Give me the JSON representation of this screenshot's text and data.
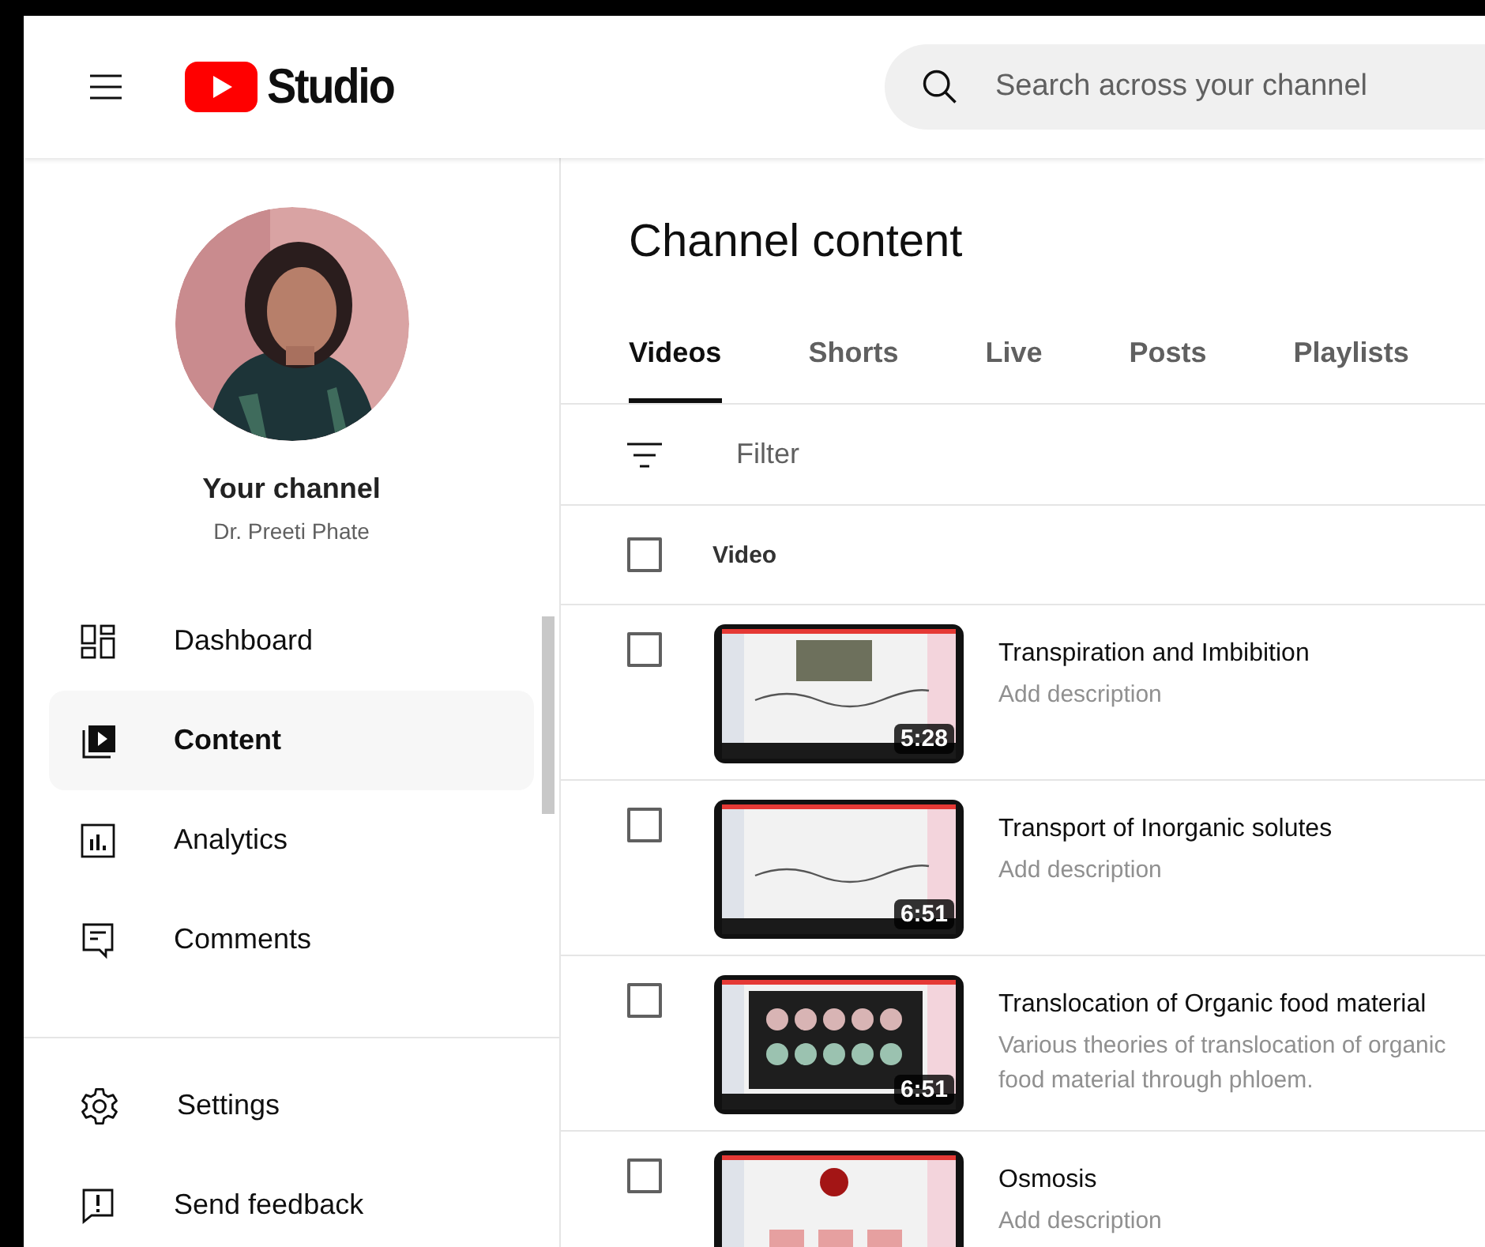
{
  "header": {
    "logo_text": "Studio",
    "search": {
      "placeholder": "Search across your channel"
    }
  },
  "channel": {
    "title": "Your channel",
    "name": "Dr. Preeti Phate"
  },
  "nav": [
    {
      "label": "Dashboard",
      "kind": "dashboard",
      "selected": false
    },
    {
      "label": "Content",
      "kind": "content",
      "selected": true
    },
    {
      "label": "Analytics",
      "kind": "analytics",
      "selected": false
    },
    {
      "label": "Comments",
      "kind": "comments",
      "selected": false
    }
  ],
  "nav_footer": [
    {
      "label": "Settings",
      "kind": "settings"
    },
    {
      "label": "Send feedback",
      "kind": "feedback"
    }
  ],
  "page_title": "Channel content",
  "tabs": [
    {
      "label": "Videos",
      "selected": true
    },
    {
      "label": "Shorts",
      "selected": false
    },
    {
      "label": "Live",
      "selected": false
    },
    {
      "label": "Posts",
      "selected": false
    },
    {
      "label": "Playlists",
      "selected": false
    }
  ],
  "filter": {
    "placeholder": "Filter"
  },
  "table": {
    "select_all": {
      "checked": false
    },
    "column": "Video",
    "rows": [
      {
        "checked": false,
        "title": "Transpiration and Imbibition",
        "description": "Add description",
        "duration": "5:28"
      },
      {
        "checked": false,
        "title": "Transport of Inorganic solutes",
        "description": "Add description",
        "duration": "6:51"
      },
      {
        "checked": false,
        "title": "Translocation of Organic food material",
        "description": "Various theories of translocation of organic food material through phloem.",
        "duration": "6:51"
      },
      {
        "checked": false,
        "title": "Osmosis",
        "description": "Add description"
      }
    ]
  }
}
